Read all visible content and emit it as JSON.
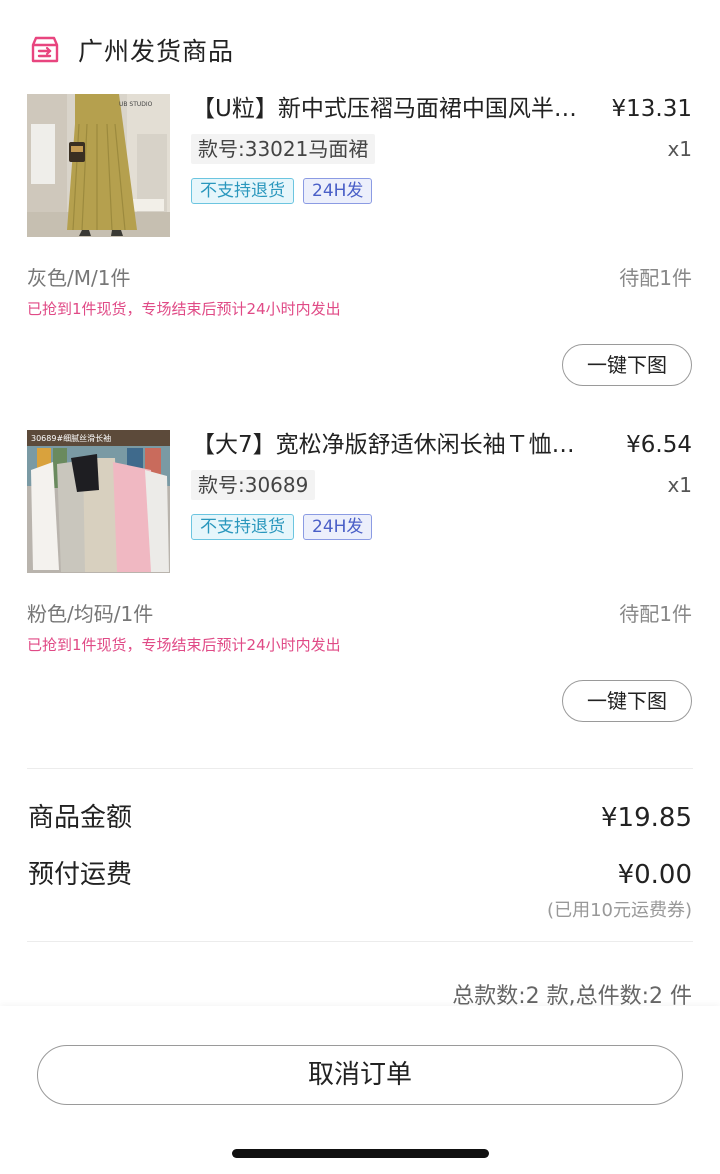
{
  "header": {
    "icon": "shipping-box-icon",
    "title": "广州发货商品",
    "accent_color": "#e8457f"
  },
  "products": [
    {
      "image": "khaki-pleated-skirt-photo",
      "title": "【U粒】新中式压褶马面裙中国风半…",
      "price": "¥13.31",
      "code": "款号:33021马面裙",
      "qty": "x1",
      "tags": [
        "不支持退货",
        "24H发"
      ],
      "spec": "灰色/M/1件",
      "pending": "待配1件",
      "note": "已抢到1件现货，专场结束后预计24小时内发出",
      "button": "一键下图"
    },
    {
      "image": "long-sleeve-tshirts-photo",
      "image_caption": "30689#细腻丝滑长袖",
      "title": "【大7】宽松净版舒适休闲长袖Ｔ恤…",
      "price": "¥6.54",
      "code": "款号:30689",
      "qty": "x1",
      "tags": [
        "不支持退货",
        "24H发"
      ],
      "spec": "粉色/均码/1件",
      "pending": "待配1件",
      "note": "已抢到1件现货，专场结束后预计24小时内发出",
      "button": "一键下图"
    }
  ],
  "summary": {
    "goods_label": "商品金额",
    "goods_value": "¥19.85",
    "shipping_label": "预付运费",
    "shipping_value": "¥0.00",
    "coupon_note": "(已用10元运费券)",
    "totals": "总款数:2 款,总件数:2 件"
  },
  "footer": {
    "cancel_label": "取消订单"
  },
  "colors": {
    "note_pink": "#e04a86",
    "tag_blue": "#2a97bd",
    "tag_indigo": "#4a5fc7"
  }
}
